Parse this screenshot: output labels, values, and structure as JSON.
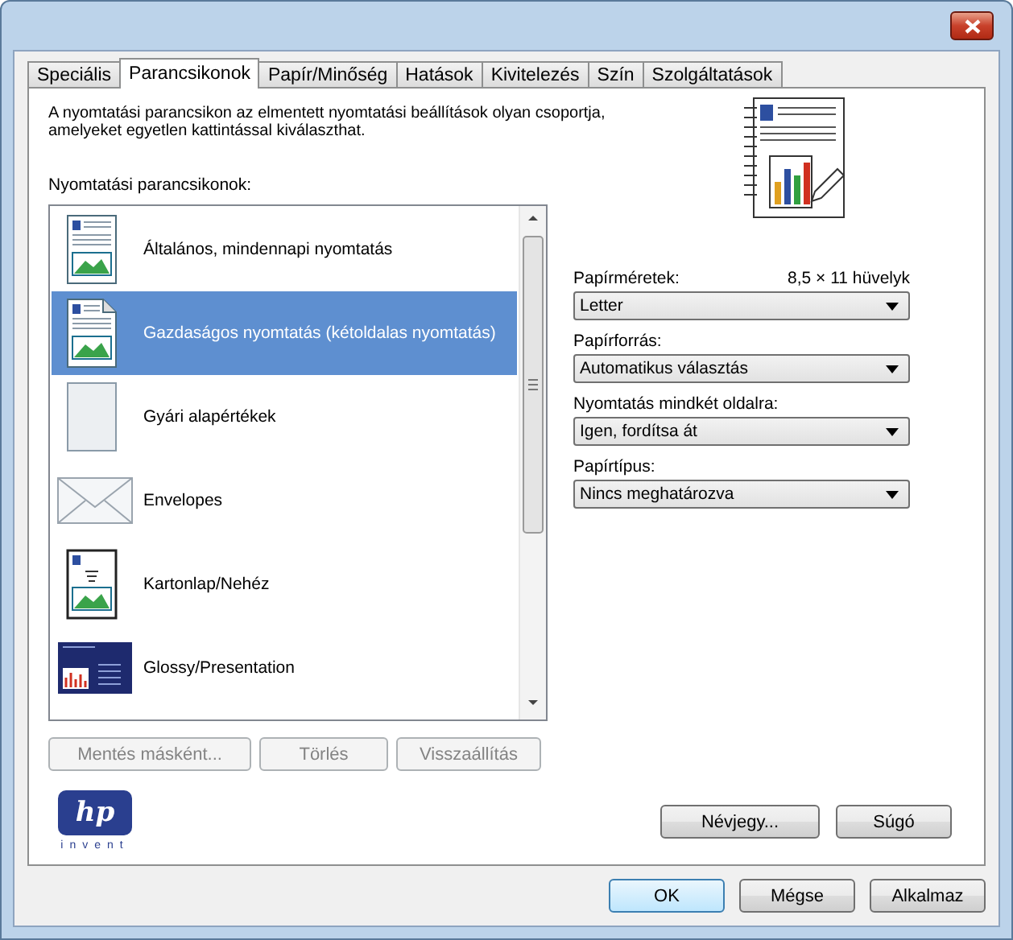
{
  "tabs": [
    {
      "label": "Speciális",
      "selected": false
    },
    {
      "label": "Parancsikonok",
      "selected": true
    },
    {
      "label": "Papír/Minőség",
      "selected": false
    },
    {
      "label": "Hatások",
      "selected": false
    },
    {
      "label": "Kivitelezés",
      "selected": false
    },
    {
      "label": "Szín",
      "selected": false
    },
    {
      "label": "Szolgáltatások",
      "selected": false
    }
  ],
  "description": "A nyomtatási parancsikon az elmentett nyomtatási beállítások olyan csoportja, amelyeket egyetlen kattintással kiválaszthat.",
  "list_label": "Nyomtatási parancsikonok:",
  "shortcuts": [
    {
      "label": "Általános, mindennapi nyomtatás",
      "kind": "document",
      "selected": false
    },
    {
      "label": "Gazdaságos nyomtatás (kétoldalas nyomtatás)",
      "kind": "duplex",
      "selected": true
    },
    {
      "label": "Gyári alapértékek",
      "kind": "blank",
      "selected": false
    },
    {
      "label": "Envelopes",
      "kind": "envelope",
      "selected": false
    },
    {
      "label": "Kartonlap/Nehéz",
      "kind": "card",
      "selected": false
    },
    {
      "label": "Glossy/Presentation",
      "kind": "presentation",
      "selected": false
    }
  ],
  "list_buttons": [
    {
      "label": "Mentés másként...",
      "disabled": true
    },
    {
      "label": "Törlés",
      "disabled": true
    },
    {
      "label": "Visszaállítás",
      "disabled": true
    }
  ],
  "settings": [
    {
      "label": "Papírméretek:",
      "note": "8,5 × 11 hüvelyk",
      "value": "Letter"
    },
    {
      "label": "Papírforrás:",
      "value": "Automatikus választás"
    },
    {
      "label": "Nyomtatás mindkét oldalra:",
      "value": "Igen, fordítsa át"
    },
    {
      "label": "Papírtípus:",
      "value": "Nincs meghatározva"
    }
  ],
  "logo": {
    "mark": "hp",
    "tagline": "invent"
  },
  "panel_buttons": [
    "Névjegy...",
    "Súgó"
  ],
  "dialog_buttons": [
    {
      "label": "OK",
      "default": true
    },
    {
      "label": "Mégse",
      "default": false
    },
    {
      "label": "Alkalmaz",
      "default": false
    }
  ]
}
